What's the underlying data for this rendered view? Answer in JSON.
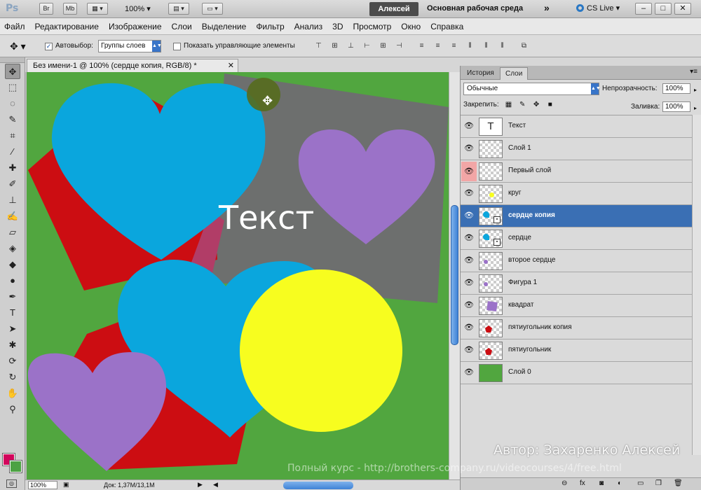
{
  "appbar": {
    "logo": "Ps",
    "bridge": "Br",
    "minibridge": "Mb",
    "zoom": "100%",
    "user": "Алексей",
    "workspace": "Основная рабочая среда",
    "more": "»",
    "cs_live": "CS Live",
    "win_min": "–",
    "win_max": "□",
    "win_close": "✕"
  },
  "menu": [
    "Файл",
    "Редактирование",
    "Изображение",
    "Слои",
    "Выделение",
    "Фильтр",
    "Анализ",
    "3D",
    "Просмотр",
    "Окно",
    "Справка"
  ],
  "options": {
    "autoselect_label": "Автовыбор:",
    "autoselect_value": "Группы слоев",
    "show_controls_label": "Показать управляющие элементы"
  },
  "document": {
    "tab_title": "Без имени-1 @ 100% (сердце копия, RGB/8) *",
    "canvas_text": "Текст",
    "status_zoom": "100%",
    "status_doc": "Док: 1,37M/13,1M"
  },
  "colors": {
    "foreground": "#d2045c",
    "background": "#4ca243",
    "canvas_green": "#51a63f",
    "heart_blue": "#0aa6dd",
    "heart_purple": "#9b72c8",
    "shape_red": "#cc0d12",
    "square_gray": "#6d6f6e",
    "circle_yellow": "#f7fd1f",
    "selection": "#3a6fb4"
  },
  "panel": {
    "tabs": [
      "История",
      "Слои"
    ],
    "blend_mode": "Обычные",
    "opacity_label": "Непрозрачность:",
    "opacity_value": "100%",
    "lock_label": "Закрепить:",
    "fill_label": "Заливка:",
    "fill_value": "100%",
    "layers": [
      {
        "name": "Текст",
        "thumb": "text",
        "selected": false
      },
      {
        "name": "Слой 1",
        "thumb": "empty",
        "selected": false
      },
      {
        "name": "Первый слой",
        "thumb": "empty",
        "selected": false,
        "eye_highlight": true
      },
      {
        "name": "круг",
        "thumb": "yellow-dot",
        "selected": false
      },
      {
        "name": "сердце копия",
        "thumb": "blue-heart-smart",
        "selected": true
      },
      {
        "name": "сердце",
        "thumb": "blue-heart-smart",
        "selected": false
      },
      {
        "name": "второе сердце",
        "thumb": "purple-dot",
        "selected": false
      },
      {
        "name": "Фигура 1",
        "thumb": "purple-dot",
        "selected": false
      },
      {
        "name": "квадрат",
        "thumb": "purple-square",
        "selected": false
      },
      {
        "name": "пятиугольник копия",
        "thumb": "red-pentagon",
        "selected": false
      },
      {
        "name": "пятиугольник",
        "thumb": "red-pentagon",
        "selected": false
      },
      {
        "name": "Слой 0",
        "thumb": "green-fill",
        "selected": false
      }
    ]
  },
  "watermark": {
    "author": "Автор: Захаренко Алексей",
    "course": "Полный курс - http://brothers-company.ru/videocourses/4/free.html"
  }
}
